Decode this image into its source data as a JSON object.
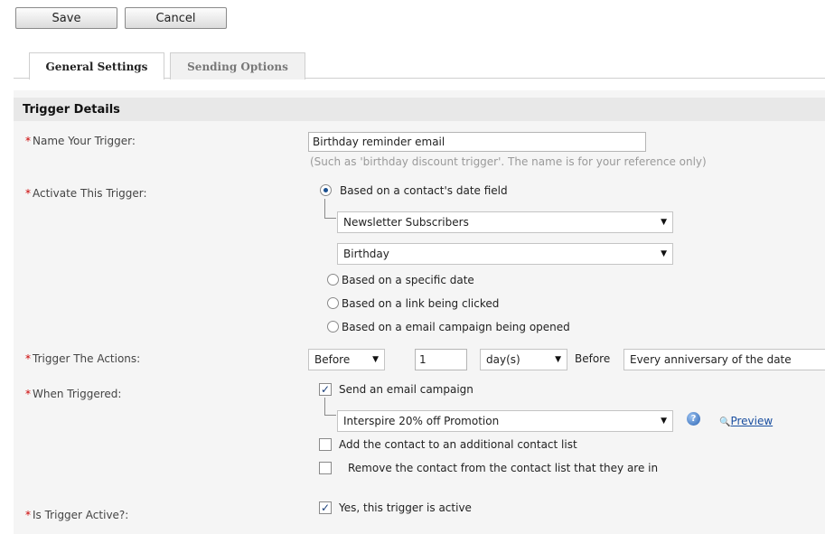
{
  "toolbar": {
    "save_label": "Save",
    "cancel_label": "Cancel"
  },
  "tabs": [
    {
      "label": "General Settings",
      "active": true
    },
    {
      "label": "Sending Options",
      "active": false
    }
  ],
  "section": {
    "title": "Trigger Details"
  },
  "required_marker": "*",
  "name": {
    "label": "Name Your Trigger:",
    "value": "Birthday reminder email",
    "hint": "(Such as 'birthday discount trigger'. The name is for your reference only)"
  },
  "activate": {
    "label": "Activate This Trigger:",
    "options": [
      {
        "label": "Based on a contact's date field",
        "selected": true
      },
      {
        "label": "Based on a specific date",
        "selected": false
      },
      {
        "label": "Based on a link being clicked",
        "selected": false
      },
      {
        "label": "Based on a email campaign being opened",
        "selected": false
      }
    ],
    "list_select": "Newsletter Subscribers",
    "field_select": "Birthday"
  },
  "actions": {
    "label": "Trigger The Actions:",
    "timing_select": "Before",
    "amount": "1",
    "unit_select": "day(s)",
    "before_text": "Before",
    "date_select": "Every anniversary of the date"
  },
  "when": {
    "label": "When Triggered:",
    "send_campaign_label": "Send an email campaign",
    "send_campaign_checked": true,
    "campaign_select": "Interspire 20% off Promotion",
    "preview_label": "Preview",
    "add_list_label": "Add the contact to an additional contact list",
    "add_list_checked": false,
    "remove_list_label": "Remove the contact from the contact list that they are in",
    "remove_list_checked": false
  },
  "active": {
    "label": "Is Trigger Active?:",
    "option_label": "Yes, this trigger is active",
    "checked": true
  },
  "icons": {
    "check": "✓",
    "caret": "▼",
    "help": "?",
    "magnifier": "🔍"
  }
}
